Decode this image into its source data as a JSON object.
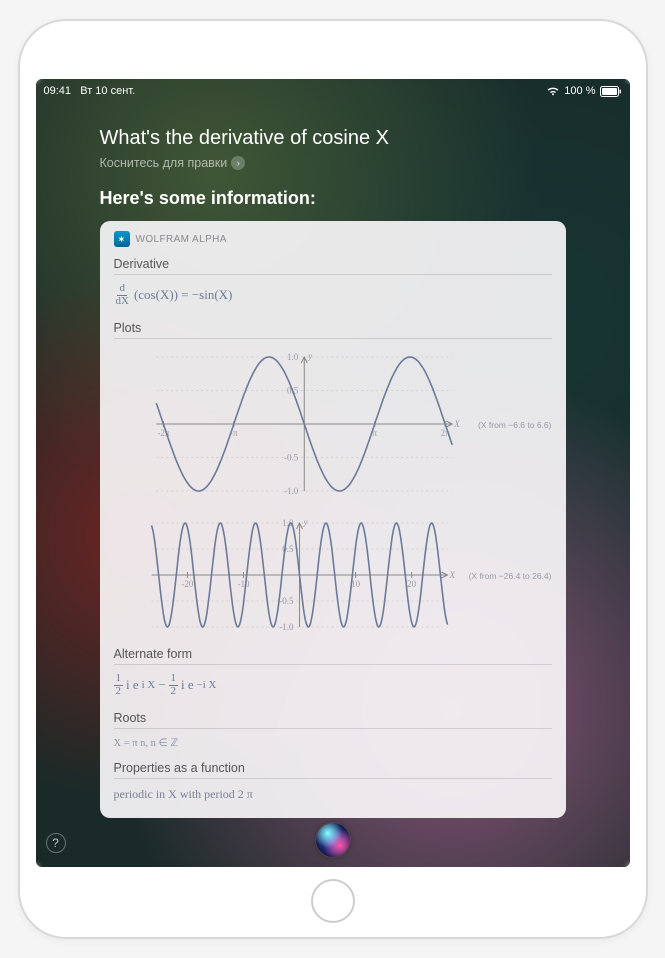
{
  "statusbar": {
    "time": "09:41",
    "date": "Вт 10 сент.",
    "battery_pct": "100 %"
  },
  "query": "What's the derivative of cosine X",
  "edit_hint": "Коснитесь для правки",
  "info_heading": "Here's some information:",
  "card": {
    "source": "WOLFRAM ALPHA",
    "sections": {
      "derivative": {
        "title": "Derivative",
        "formula_lhs_top": "d",
        "formula_lhs_bot": "dX",
        "formula_body": "(cos(X)) = −sin(X)"
      },
      "plots": {
        "title": "Plots"
      },
      "alt": {
        "title": "Alternate form",
        "term1_top": "1",
        "term1_bot": "2",
        "term1_rest": " i e",
        "term1_exp": "i X",
        "minus": " − ",
        "term2_top": "1",
        "term2_bot": "2",
        "term2_rest": " i e",
        "term2_exp": "−i X"
      },
      "roots": {
        "title": "Roots",
        "text": "X = π n,   n ∈ ℤ"
      },
      "props": {
        "title": "Properties as a function",
        "text": "periodic in X with period 2 π"
      }
    }
  },
  "chart_data": [
    {
      "type": "line",
      "title": "",
      "xlabel": "X",
      "ylabel": "y",
      "x_range_label": "(X from −6.6 to 6.6)",
      "xlim": [
        -6.6,
        6.6
      ],
      "ylim": [
        -1.0,
        1.0
      ],
      "x_ticks": [
        "-2π",
        "-π",
        "π",
        "2π"
      ],
      "y_ticks": [
        -1.0,
        -0.5,
        0.5,
        1.0
      ],
      "series": [
        {
          "name": "−sin(X)",
          "function": "-sin(x)"
        }
      ]
    },
    {
      "type": "line",
      "title": "",
      "xlabel": "X",
      "ylabel": "y",
      "x_range_label": "(X from −26.4 to 26.4)",
      "xlim": [
        -26.4,
        26.4
      ],
      "ylim": [
        -1.0,
        1.0
      ],
      "x_ticks": [
        -20,
        -10,
        10,
        20
      ],
      "y_ticks": [
        -1.0,
        -0.5,
        0.5,
        1.0
      ],
      "series": [
        {
          "name": "−sin(X)",
          "function": "-sin(x)"
        }
      ]
    }
  ]
}
